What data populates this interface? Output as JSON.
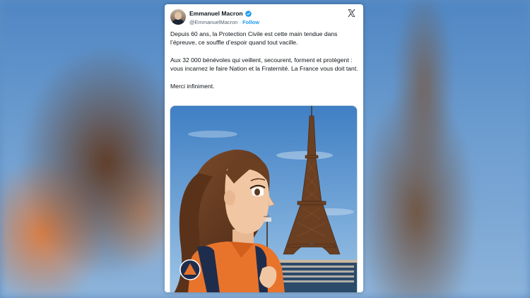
{
  "tweet": {
    "author_name": "Emmanuel Macron",
    "handle": "@EmmanuelMacron",
    "separator": "·",
    "follow_label": "Follow",
    "paragraphs": [
      "Depuis 60 ans, la Protection Civile est cette main tendue dans l’épreuve, ce souffle d’espoir quand tout vacille.",
      "Aux 32 000 bénévoles qui veillent, secourent, forment et protègent : vous incarnez le faire Nation et la Fraternité. La France vous doit tant.",
      "Merci infiniment."
    ]
  },
  "colors": {
    "link": "#1d9bf0",
    "verified": "#1d9bf0",
    "text": "#0f1419",
    "secondary": "#536471",
    "uniform_orange": "#e8742c",
    "sky": "#6ea3d6"
  },
  "icons": {
    "verified": "verified-badge-icon",
    "platform": "x-logo-icon"
  },
  "media": {
    "description_icon": "illustration-image"
  }
}
